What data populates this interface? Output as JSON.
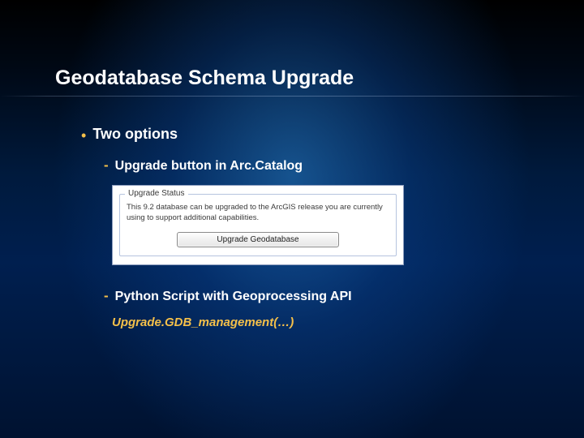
{
  "title": "Geodatabase Schema Upgrade",
  "bullets": {
    "b1": {
      "marker": "•",
      "text": "Two options"
    }
  },
  "subs": {
    "s1": {
      "marker": "-",
      "text": "Upgrade button in Arc.Catalog"
    },
    "s2": {
      "marker": "-",
      "text": "Python Script with Geoprocessing API"
    }
  },
  "dialog": {
    "group_title": "Upgrade Status",
    "body": "This 9.2 database can be upgraded to the ArcGIS release you are currently using to support additional capabilities.",
    "button": "Upgrade Geodatabase"
  },
  "code": "Upgrade.GDB_management(…)"
}
